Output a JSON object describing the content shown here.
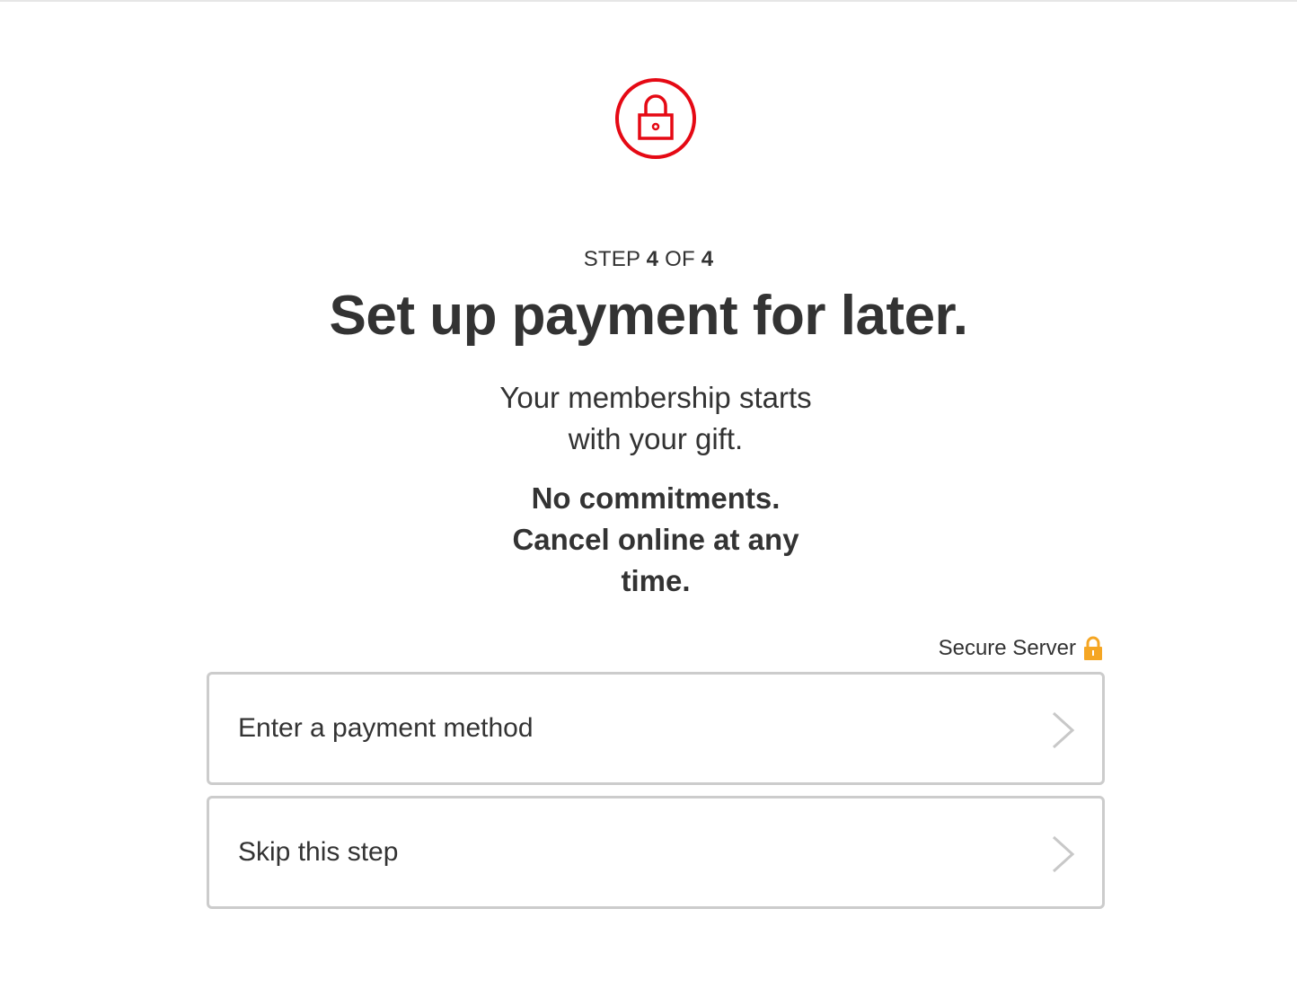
{
  "header": {
    "icon": "lock-circle-icon",
    "accent_color": "#e50914"
  },
  "step": {
    "prefix": "STEP",
    "current": "4",
    "of_label": "OF",
    "total": "4"
  },
  "title": "Set up payment for later.",
  "membership_line1": "Your membership starts",
  "membership_line2": "with your gift.",
  "commitment_line1": "No commitments.",
  "commitment_line2": "Cancel online at any",
  "commitment_line3": "time.",
  "secure": {
    "label": "Secure Server",
    "icon": "padlock-icon",
    "icon_color": "#f5a623"
  },
  "options": [
    {
      "label": "Enter a payment method",
      "icon": "chevron-right-icon"
    },
    {
      "label": "Skip this step",
      "icon": "chevron-right-icon"
    }
  ]
}
